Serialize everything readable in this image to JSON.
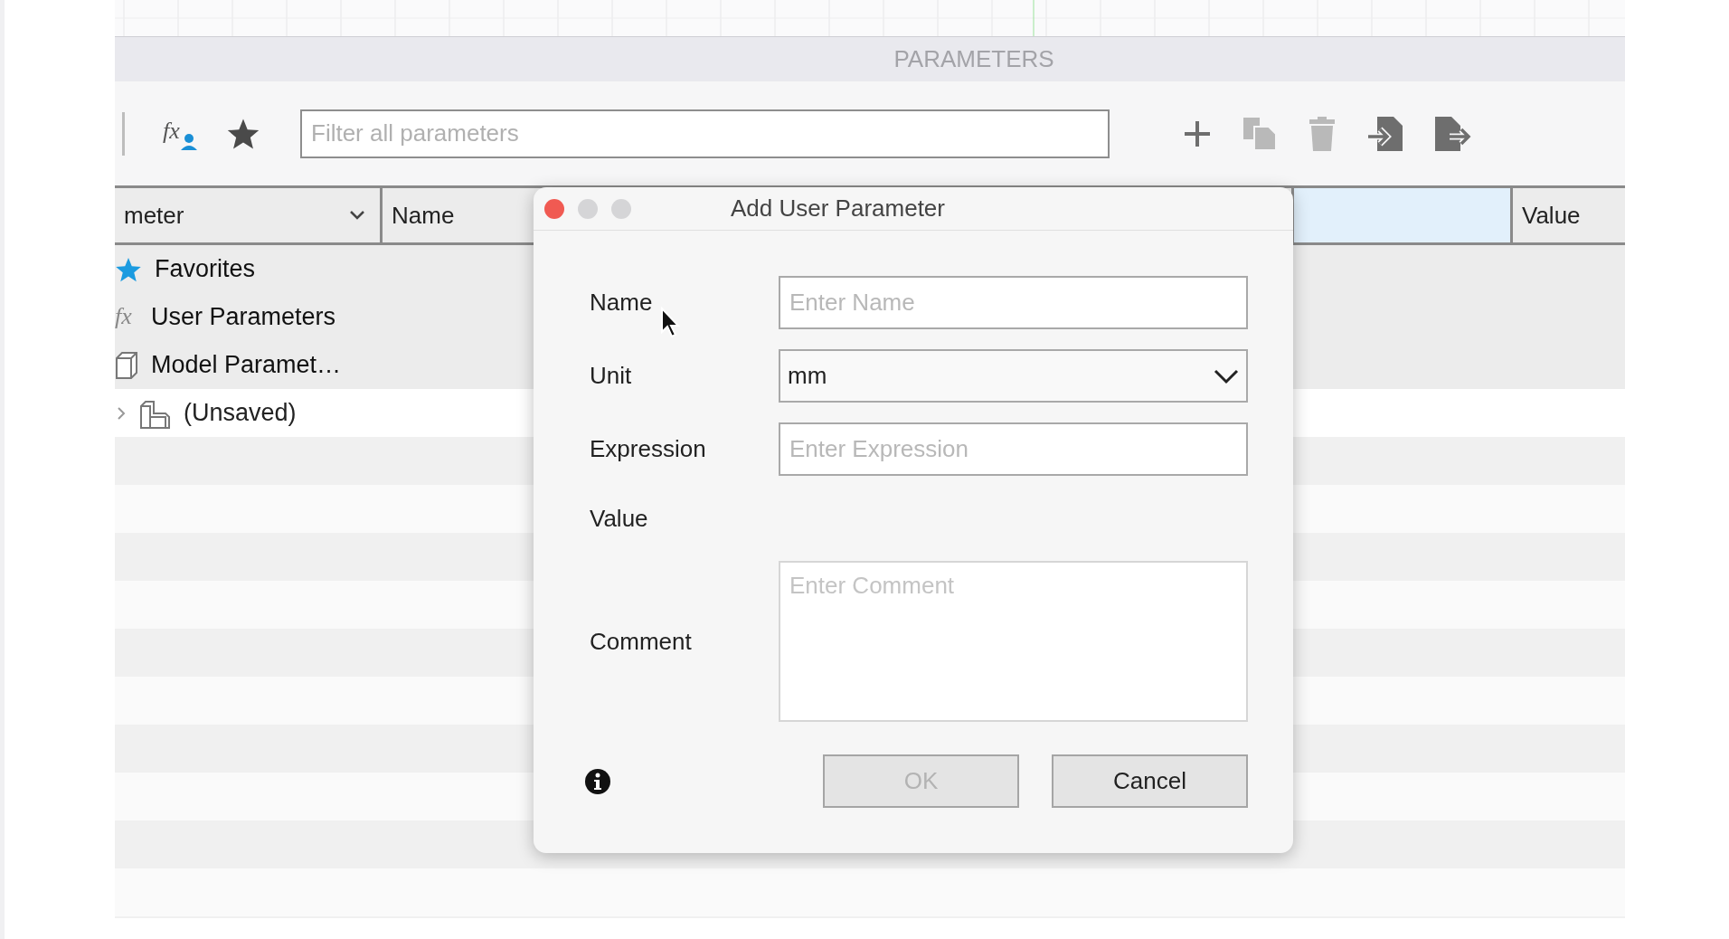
{
  "panel": {
    "title": "PARAMETERS"
  },
  "toolbar": {
    "left_tools": [
      {
        "kind": "user-formula",
        "glyph": "fx"
      },
      {
        "kind": "favorite"
      }
    ],
    "filter": {
      "placeholder": "Filter all parameters"
    },
    "right_tools": [
      {
        "kind": "add",
        "disabled": false
      },
      {
        "kind": "copy",
        "disabled": true
      },
      {
        "kind": "delete",
        "disabled": true
      },
      {
        "kind": "import",
        "disabled": false
      },
      {
        "kind": "export",
        "disabled": false
      }
    ]
  },
  "table": {
    "columns": [
      {
        "label": "meter",
        "kind": "dropdown",
        "selected": false
      },
      {
        "label": "Name",
        "kind": "plain",
        "selected": false
      },
      {
        "kind": "blank",
        "selected": true
      },
      {
        "label": "Value",
        "kind": "plain",
        "selected": false
      }
    ],
    "tree": [
      {
        "label": "Favorites",
        "kind": "favorites"
      },
      {
        "label": "User Parameters",
        "kind": "user",
        "glyph": "fx"
      },
      {
        "label": "Model Paramet…",
        "kind": "model",
        "children": [
          {
            "label": "(Unsaved)",
            "kind": "design",
            "expanded": false
          }
        ]
      }
    ]
  },
  "dialog": {
    "title": "Add User Parameter",
    "fields": [
      {
        "label": "Name",
        "kind": "text",
        "placeholder": "Enter Name"
      },
      {
        "label": "Unit",
        "kind": "dropdown",
        "value": "mm"
      },
      {
        "label": "Expression",
        "kind": "text",
        "placeholder": "Enter Expression"
      },
      {
        "label": "Value",
        "kind": "readout"
      },
      {
        "label": "Comment",
        "kind": "textarea",
        "placeholder": "Enter Comment"
      }
    ],
    "buttons": [
      {
        "label": "OK",
        "disabled": true
      },
      {
        "label": "Cancel",
        "disabled": false
      }
    ]
  }
}
